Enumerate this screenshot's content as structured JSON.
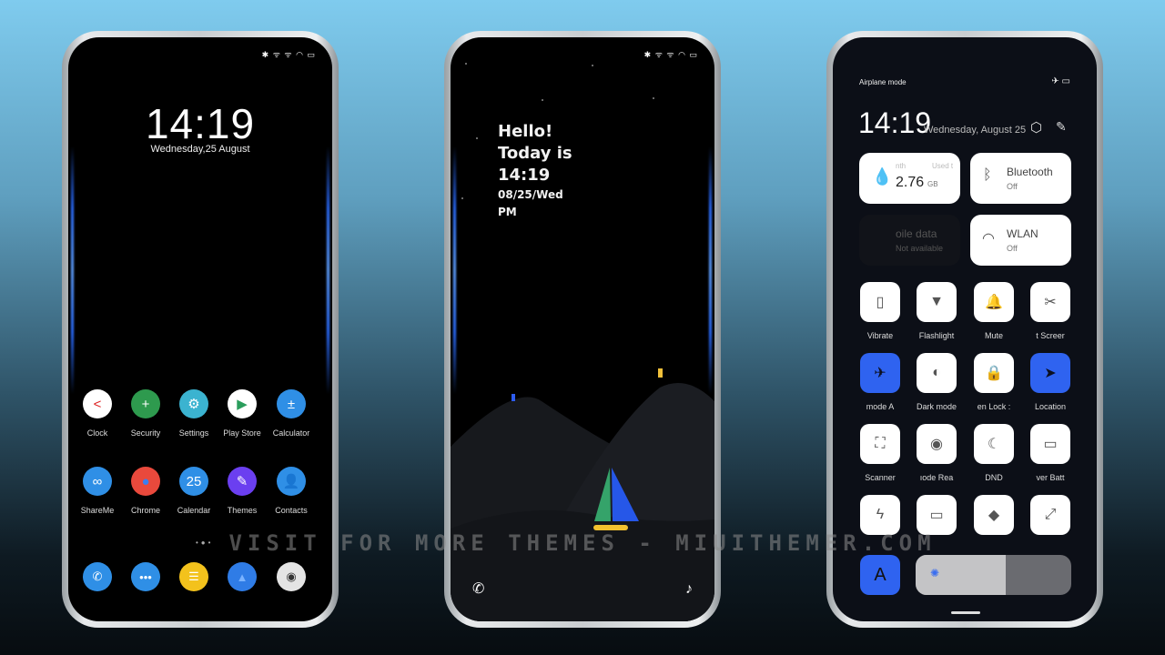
{
  "watermark": "VISIT FOR MORE THEMES - MIUITHEMER.COM",
  "colors": {
    "accent": "#2f63f0",
    "sail_green": "#35a36a",
    "sail_blue": "#2657e8",
    "boat_yellow": "#f2c12e"
  },
  "home": {
    "status": "✱ ᯤ ᯤ ◠ ▭",
    "time": "14:19",
    "date": "Wednesday,25 August",
    "apps": [
      {
        "label": "Clock",
        "icon": "clock-icon",
        "glyph": "<",
        "color": "#ffffff",
        "fg": "#d22"
      },
      {
        "label": "Security",
        "icon": "shield-icon",
        "glyph": "+",
        "color": "#2e9a4e",
        "fg": "#fff"
      },
      {
        "label": "Settings",
        "icon": "gear-icon",
        "glyph": "⚙",
        "color": "#3bb3d0",
        "fg": "#fff"
      },
      {
        "label": "Play Store",
        "icon": "play-store-icon",
        "glyph": "▶",
        "color": "#ffffff",
        "fg": "#2a9d5c"
      },
      {
        "label": "Calculator",
        "icon": "calculator-icon",
        "glyph": "±",
        "color": "#2f8fe6",
        "fg": "#fff"
      },
      {
        "label": "ShareMe",
        "icon": "infinity-icon",
        "glyph": "∞",
        "color": "#2f8fe6",
        "fg": "#fff"
      },
      {
        "label": "Chrome",
        "icon": "chrome-icon",
        "glyph": "●",
        "color": "#e9493c",
        "fg": "#3a7ef0"
      },
      {
        "label": "Calendar",
        "icon": "calendar-icon",
        "glyph": "25",
        "color": "#2f8fe6",
        "fg": "#fff"
      },
      {
        "label": "Themes",
        "icon": "brush-icon",
        "glyph": "✎",
        "color": "#6b3ff0",
        "fg": "#fff"
      },
      {
        "label": "Contacts",
        "icon": "contact-icon",
        "glyph": "👤",
        "color": "#2f8fe6",
        "fg": "#fff"
      }
    ],
    "dock": [
      {
        "icon": "phone-icon",
        "glyph": "✆",
        "color": "#2f8fe6",
        "fg": "#fff"
      },
      {
        "icon": "messages-icon",
        "glyph": "•••",
        "color": "#2f8fe6",
        "fg": "#fff"
      },
      {
        "icon": "notes-icon",
        "glyph": "☰",
        "color": "#f3c21c",
        "fg": "#fff"
      },
      {
        "icon": "gallery-icon",
        "glyph": "▲",
        "color": "#2f7ce6",
        "fg": "#7ab3ff"
      },
      {
        "icon": "camera-icon",
        "glyph": "◉",
        "color": "#e4e4e4",
        "fg": "#333"
      }
    ]
  },
  "lock": {
    "status": "✱ ᯤ ᯤ ◠ ▭",
    "line1": "Hello!",
    "line2": "Today is",
    "line3": "14:19",
    "line4": "08/25/Wed",
    "line5": "PM"
  },
  "control": {
    "mode": "Airplane mode",
    "status": "✈ ▭",
    "time": "14:19",
    "date": "Wednesday, August 25",
    "data_card": {
      "label_a": "nth",
      "label_b": "Used t",
      "value": "2.76",
      "unit": "GB"
    },
    "bluetooth": {
      "title": "Bluetooth",
      "state": "Off"
    },
    "mobile": {
      "title": "oile data",
      "state": "Not available"
    },
    "wlan": {
      "title": "WLAN",
      "state": "Off"
    },
    "tiles": [
      {
        "label": "Vibrate",
        "icon": "vibrate-icon",
        "glyph": "▯",
        "on": false
      },
      {
        "label": "Flashlight",
        "icon": "flashlight-icon",
        "glyph": "▼",
        "on": false
      },
      {
        "label": "Mute",
        "icon": "bell-icon",
        "glyph": "🔔",
        "on": false
      },
      {
        "label": "t   Screer",
        "icon": "screenshot-icon",
        "glyph": "✂",
        "on": false
      },
      {
        "label": "mode   A",
        "icon": "airplane-icon",
        "glyph": "✈",
        "on": true
      },
      {
        "label": "Dark mode",
        "icon": "dark-mode-icon",
        "glyph": "◐",
        "on": false
      },
      {
        "label": "en   Lock :",
        "icon": "lock-icon",
        "glyph": "🔒",
        "on": false
      },
      {
        "label": "Location",
        "icon": "location-icon",
        "glyph": "➤",
        "on": true
      },
      {
        "label": "Scanner",
        "icon": "scanner-icon",
        "glyph": "⛶",
        "on": false
      },
      {
        "label": "ıode   Rea",
        "icon": "eye-icon",
        "glyph": "◉",
        "on": false
      },
      {
        "label": "DND",
        "icon": "moon-icon",
        "glyph": "☾",
        "on": false
      },
      {
        "label": "ver   Batt",
        "icon": "battery-icon",
        "glyph": "▭",
        "on": false
      },
      {
        "label": "",
        "icon": "lightning-icon",
        "glyph": "ϟ",
        "on": false
      },
      {
        "label": "",
        "icon": "monitor-icon",
        "glyph": "▭",
        "on": false
      },
      {
        "label": "",
        "icon": "code-icon",
        "glyph": "◆",
        "on": false
      },
      {
        "label": "",
        "icon": "resize-icon",
        "glyph": "⤢",
        "on": false
      }
    ],
    "auto_brightness": "A",
    "brightness_percent": 58
  }
}
